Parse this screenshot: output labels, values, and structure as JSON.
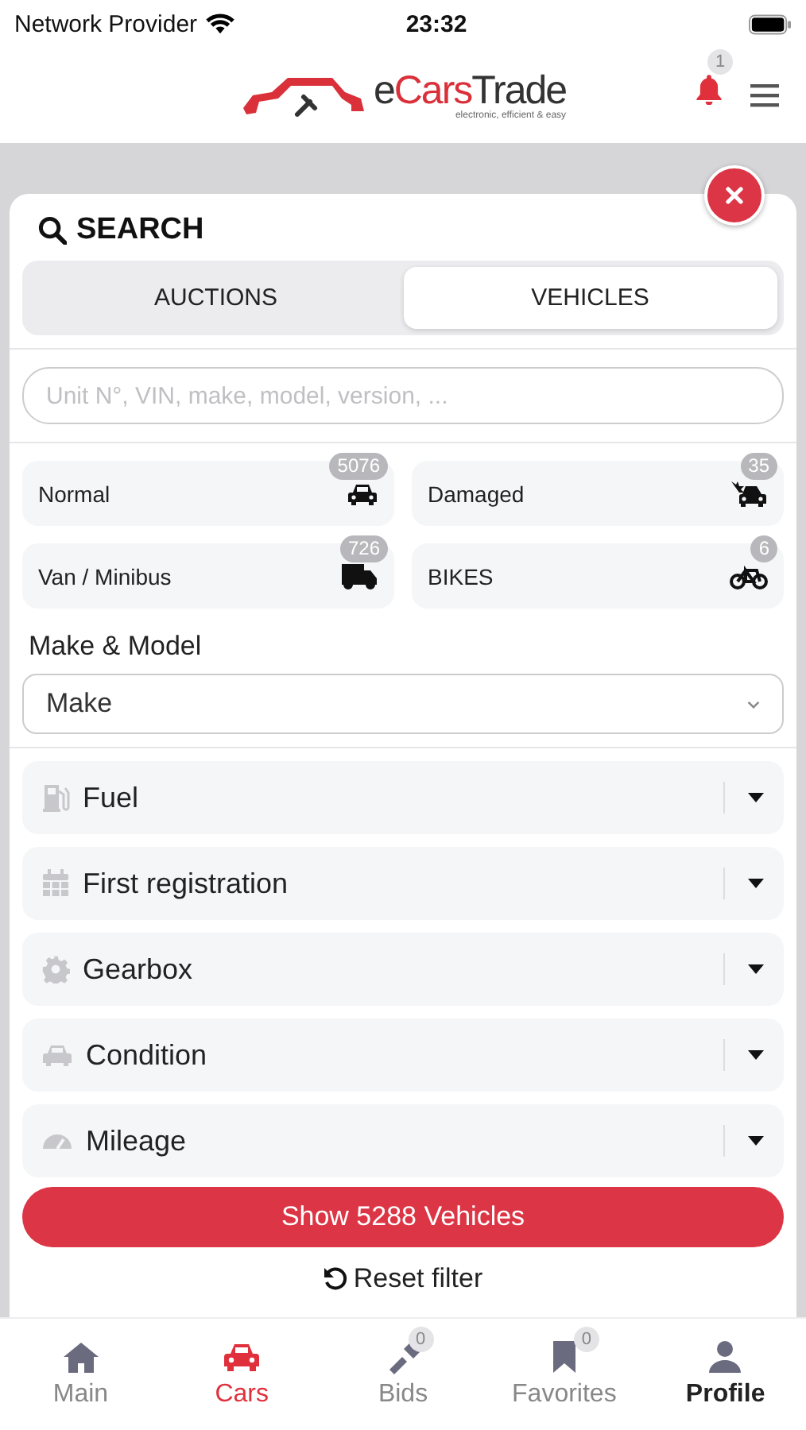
{
  "status_bar": {
    "carrier": "Network Provider",
    "time": "23:32"
  },
  "header": {
    "logo": {
      "parts": [
        {
          "text": "e",
          "accent": false
        },
        {
          "text": "Cars",
          "accent": true
        },
        {
          "text": "Trade",
          "accent": false
        }
      ],
      "tagline": "electronic, efficient & easy"
    },
    "notifications": "1"
  },
  "search_panel": {
    "title": "SEARCH",
    "tabs": [
      {
        "label": "AUCTIONS",
        "selected": false
      },
      {
        "label": "VEHICLES",
        "selected": true
      }
    ],
    "search": {
      "placeholder": "Unit N°, VIN, make, model, version, ..."
    },
    "categories": [
      {
        "label": "Normal",
        "count": "5076"
      },
      {
        "label": "Damaged",
        "count": "35"
      },
      {
        "label": "Van / Minibus",
        "count": "726"
      },
      {
        "label": "BIKES",
        "count": "6"
      }
    ],
    "make_model": {
      "label": "Make & Model",
      "select": "Make"
    },
    "filters": [
      "Fuel",
      "First registration",
      "Gearbox",
      "Condition",
      "Mileage"
    ],
    "show_button": "Show 5288 Vehicles",
    "reset": "Reset filter"
  },
  "tab_bar": [
    {
      "label": "Main",
      "selected": false,
      "emphasized": false
    },
    {
      "label": "Cars",
      "selected": true,
      "emphasized": false
    },
    {
      "label": "Bids",
      "selected": false,
      "emphasized": false,
      "badge": "0"
    },
    {
      "label": "Favorites",
      "selected": false,
      "emphasized": false,
      "badge": "0"
    },
    {
      "label": "Profile",
      "selected": false,
      "emphasized": true
    }
  ]
}
